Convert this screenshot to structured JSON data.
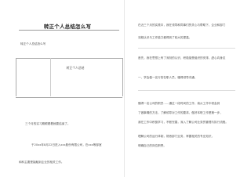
{
  "doc": {
    "title": "转正个人总结怎么写",
    "subtitle": "转正个人总结怎么写",
    "box_title": "转正个人总结",
    "left_lines": [
      "三个月的实习期眼看着就要结束了。",
      "于20xx年8月22日进入xxx股份有限公司，在xxx等部室",
      "和科主要是接触到企业的相关工作。"
    ],
    "right_lines": [
      "在近三个月的实践中，我在领导和同事们的关心与帮助下，企业和部门",
      "流程认识与工作能力都得到了较大的提高。",
      "首先，我在思想上有了深刻的认识，积极接受组织的安排，虚心向身边",
      "一、学会做一名行的在职人员，懂得领导沟通，",
      "懂得一名公司的职员……通过一段时间的工作，我从工作中领会到",
      "了做事情的方法，了解领导对工作的要求。做好本职工作是第一步，",
      "我在工作中积极学习，不断完善，深入了解公司业务的管理与执行流程。",
      "理解公司的运行体制，熟悉部门业务，掌握相关的专业知识，",
      "明确自己的岗位职责。"
    ]
  }
}
